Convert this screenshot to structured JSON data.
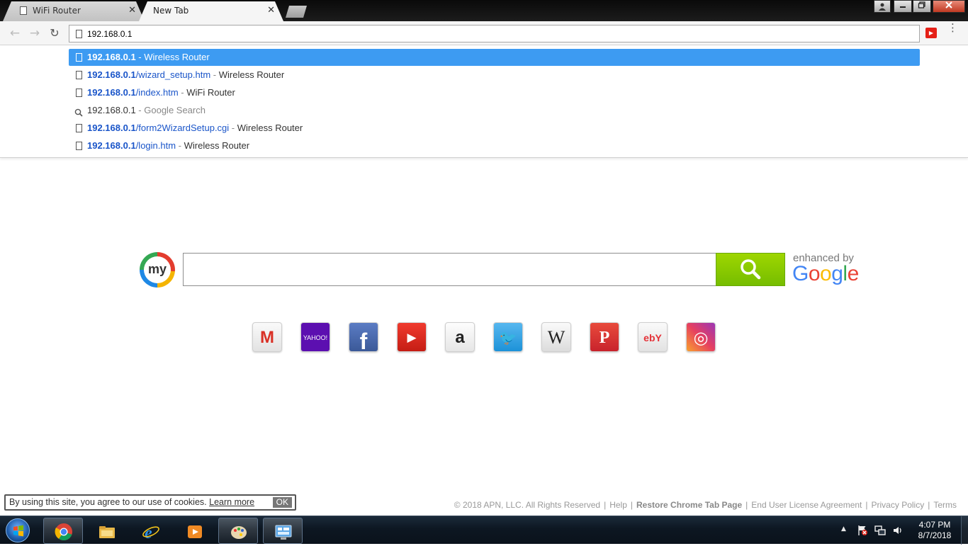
{
  "tabs": [
    {
      "title": "WiFi Router",
      "active": false
    },
    {
      "title": "New Tab",
      "active": true
    }
  ],
  "tab_close_glyph": "✕",
  "window_controls": [
    "user-icon",
    "minimize-icon",
    "restore-icon",
    "close-icon"
  ],
  "toolbar": {
    "back_icon": "←",
    "forward_icon": "→",
    "reload_icon": "↻",
    "address_value": "192.168.0.1",
    "extension": "youtube-icon",
    "menu_icon": "⋮"
  },
  "suggestions": [
    {
      "host": "192.168.0.1",
      "path": "",
      "sep": " - ",
      "title": "Wireless Router",
      "type": "page",
      "selected": true
    },
    {
      "host": "192.168.0.1",
      "path": "/wizard_setup.htm",
      "sep": " - ",
      "title": "Wireless Router",
      "type": "page",
      "selected": false
    },
    {
      "host": "192.168.0.1",
      "path": "/index.htm",
      "sep": " - ",
      "title": "WiFi Router",
      "type": "page",
      "selected": false
    },
    {
      "host": "192.168.0.1",
      "path": "",
      "sep": " - ",
      "title": "Google Search",
      "type": "search",
      "selected": false
    },
    {
      "host": "192.168.0.1",
      "path": "/form2WizardSetup.cgi",
      "sep": " - ",
      "title": "Wireless Router",
      "type": "page",
      "selected": false
    },
    {
      "host": "192.168.0.1",
      "path": "/login.htm",
      "sep": " - ",
      "title": "Wireless Router",
      "type": "page",
      "selected": false
    }
  ],
  "search": {
    "logo_text": "my",
    "placeholder": "",
    "enhanced_label": "enhanced by",
    "google_letters": [
      {
        "ch": "G",
        "color": "#4285f4"
      },
      {
        "ch": "o",
        "color": "#ea4335"
      },
      {
        "ch": "o",
        "color": "#fbbc05"
      },
      {
        "ch": "g",
        "color": "#4285f4"
      },
      {
        "ch": "l",
        "color": "#34a853"
      },
      {
        "ch": "e",
        "color": "#ea4335"
      }
    ]
  },
  "quick_links": [
    {
      "name": "gmail",
      "icon": "gmail-icon",
      "label": "M"
    },
    {
      "name": "yahoo",
      "icon": "yahoo-icon",
      "label": "YAHOO!"
    },
    {
      "name": "facebook",
      "icon": "facebook-icon",
      "label": "f"
    },
    {
      "name": "youtube",
      "icon": "youtube-icon",
      "label": "▶"
    },
    {
      "name": "amazon",
      "icon": "amazon-icon",
      "label": "a"
    },
    {
      "name": "twitter",
      "icon": "twitter-icon",
      "label": "🐦"
    },
    {
      "name": "wikipedia",
      "icon": "wikipedia-icon",
      "label": "W"
    },
    {
      "name": "pinterest",
      "icon": "pinterest-icon",
      "label": "P"
    },
    {
      "name": "ebay",
      "icon": "ebay-icon",
      "label": "ebY"
    },
    {
      "name": "instagram",
      "icon": "instagram-icon",
      "label": "◎"
    }
  ],
  "cookie": {
    "text": "By using this site, you agree to our use of cookies.",
    "learn_more": "Learn more",
    "ok": "OK"
  },
  "footer": {
    "copyright": "© 2018 APN, LLC. All Rights Reserved",
    "help": "Help",
    "restore": "Restore Chrome Tab Page",
    "eula": "End User License Agreement",
    "privacy": "Privacy Policy",
    "terms": "Terms"
  },
  "taskbar": {
    "apps": [
      "chrome-icon",
      "file-explorer-icon",
      "internet-explorer-icon",
      "media-player-icon",
      "paint-icon",
      "control-panel-icon"
    ],
    "tray_arrow": "▲",
    "time": "4:07 PM",
    "date": "8/7/2018"
  },
  "colors": {
    "suggestion_selected": "#3d9bf2",
    "url_blue": "#1a55c9",
    "search_button_green": "#8cc900"
  }
}
